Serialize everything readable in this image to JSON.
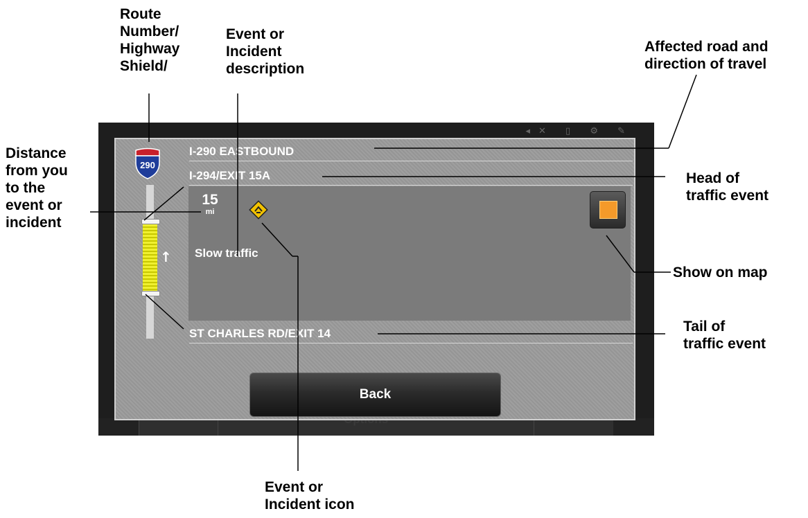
{
  "callouts": {
    "route_shield": "Route\nNumber/\nHighway\nShield/",
    "event_description": "Event or\nIncident\ndescription",
    "affected_road": "Affected road and\ndirection of travel",
    "distance": "Distance\nfrom you\nto the\nevent or\nincident",
    "head": "Head of\ntraffic event",
    "show_on_map": "Show on map",
    "tail": "Tail of\ntraffic event",
    "event_icon": "Event or\nIncident  icon"
  },
  "screen": {
    "road": "I-290 EASTBOUND",
    "head_location": "I-294/EXIT 15A",
    "tail_location": "ST CHARLES RD/EXIT 14",
    "shield_number": "290",
    "distance_value": "15",
    "distance_unit": "mi",
    "description": "Slow traffic",
    "back_label": "Back",
    "options_label": "Options"
  },
  "icons": {
    "shield": "interstate-shield-icon",
    "incident": "slow-traffic-warning-icon",
    "map": "show-on-map-icon",
    "direction": "arrow-up-icon"
  },
  "colors": {
    "shield_blue": "#1f3d9a",
    "shield_red": "#c8202a",
    "incident_yellow": "#f2c200",
    "map_orange": "#f49a2a",
    "congestion_yellow": "#f0f030"
  }
}
